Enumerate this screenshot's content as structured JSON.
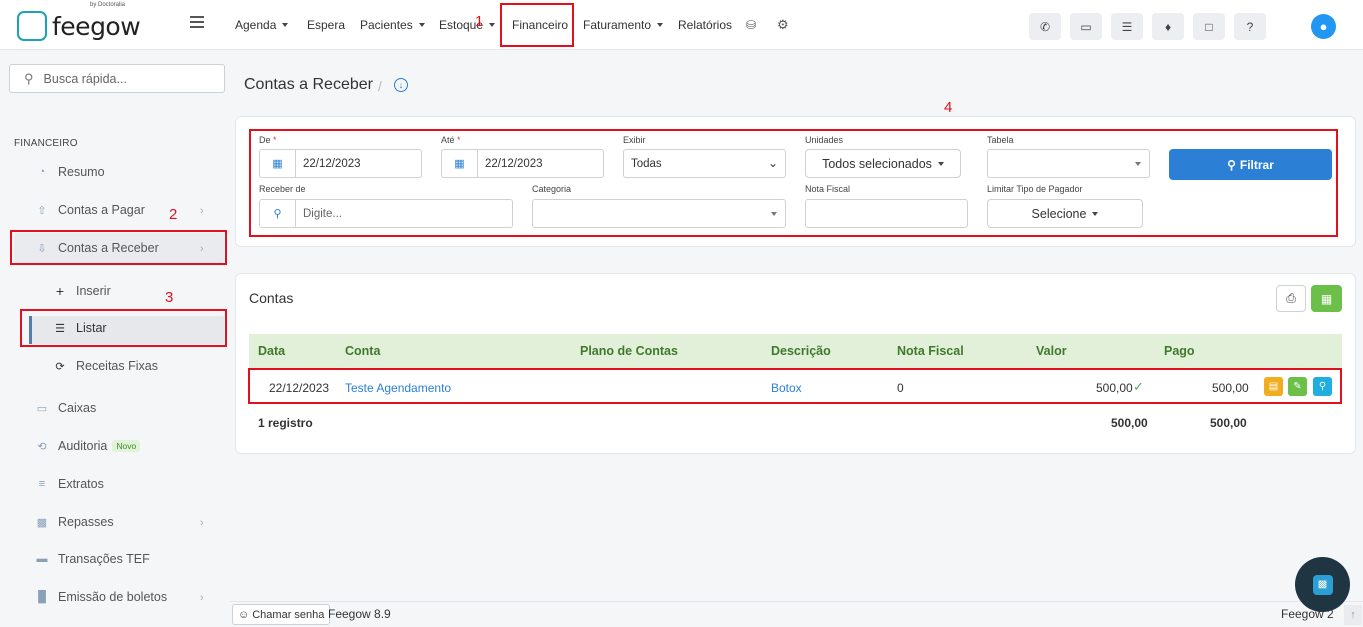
{
  "app": {
    "logo_text": "feegow",
    "logo_by": "by Doctoralia"
  },
  "nav": [
    {
      "label": "Agenda",
      "dropdown": true
    },
    {
      "label": "Espera",
      "dropdown": false
    },
    {
      "label": "Pacientes",
      "dropdown": true
    },
    {
      "label": "Estoque",
      "dropdown": true
    },
    {
      "label": "Financeiro",
      "dropdown": false
    },
    {
      "label": "Faturamento",
      "dropdown": true
    },
    {
      "label": "Relatórios",
      "dropdown": false
    }
  ],
  "top_icons": [
    "database-icon",
    "gear-icon",
    "phone-icon",
    "inbox-icon",
    "checklist-icon",
    "bell-icon",
    "chat-icon",
    "help-icon",
    "user-icon"
  ],
  "sidebar": {
    "search_placeholder": "Busca rápida...",
    "section": "FINANCEIRO",
    "items": [
      {
        "label": "Resumo",
        "icon": "pie-chart-icon"
      },
      {
        "label": "Contas a Pagar",
        "icon": "arrow-up-circle-icon"
      },
      {
        "label": "Contas a Receber",
        "icon": "arrow-down-circle-icon"
      },
      {
        "label": "Inserir",
        "icon": "plus-icon"
      },
      {
        "label": "Listar",
        "icon": "list-icon"
      },
      {
        "label": "Receitas Fixas",
        "icon": "refresh-icon"
      },
      {
        "label": "Caixas",
        "icon": "inbox-icon"
      },
      {
        "label": "Auditoria",
        "icon": "history-icon",
        "badge": "Novo"
      },
      {
        "label": "Extratos",
        "icon": "menu-icon"
      },
      {
        "label": "Repasses",
        "icon": "sitemap-icon"
      },
      {
        "label": "Transações TEF",
        "icon": "card-icon"
      },
      {
        "label": "Emissão de boletos",
        "icon": "barcode-icon"
      }
    ]
  },
  "page": {
    "title": "Contas a Receber",
    "separator": "/"
  },
  "filters": {
    "de_label": "De",
    "de_value": "22/12/2023",
    "ate_label": "Até",
    "ate_value": "22/12/2023",
    "exibir_label": "Exibir",
    "exibir_value": "Todas",
    "unidades_label": "Unidades",
    "unidades_value": "Todos selecionados",
    "tabela_label": "Tabela",
    "tabela_value": "",
    "receber_label": "Receber de",
    "receber_placeholder": "Digite...",
    "categoria_label": "Categoria",
    "categoria_value": "",
    "nota_label": "Nota Fiscal",
    "nota_value": "",
    "limitar_label": "Limitar Tipo de Pagador",
    "limitar_value": "Selecione",
    "filtrar_label": "Filtrar",
    "required_mark": "*"
  },
  "contas": {
    "title": "Contas",
    "columns": [
      "Data",
      "Conta",
      "Plano de Contas",
      "Descrição",
      "Nota Fiscal",
      "Valor",
      "Pago"
    ],
    "rows": [
      {
        "data": "22/12/2023",
        "conta": "Teste Agendamento",
        "plano": "",
        "descricao": "Botox",
        "nota": "0",
        "valor": "500,00",
        "pago": "500,00"
      }
    ],
    "footer": {
      "count": "1 registro",
      "valor_total": "500,00",
      "pago_total": "500,00"
    }
  },
  "bottom": {
    "chamar": "Chamar senha",
    "version": "Feegow 8.9",
    "version_right": "Feegow 2"
  },
  "annotations": [
    "1",
    "2",
    "3",
    "4"
  ],
  "colors": {
    "primary": "#2b7fd4",
    "success": "#6cc04a",
    "warning": "#f0ad1f",
    "info": "#1eaee0",
    "annotation": "#e0101e"
  }
}
